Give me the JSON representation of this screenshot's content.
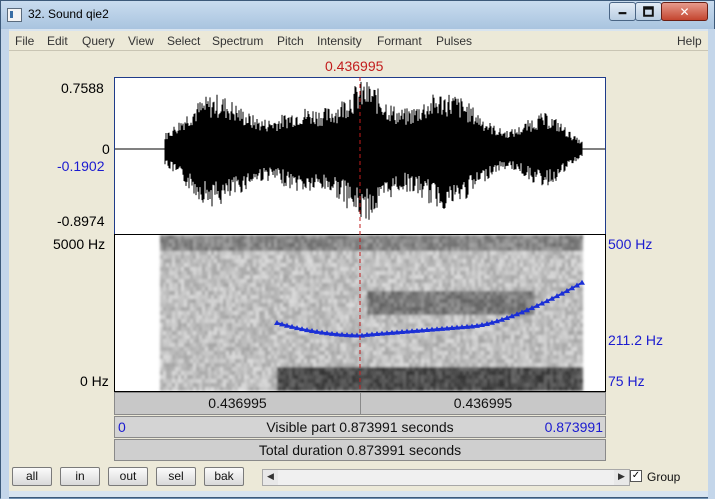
{
  "window": {
    "title": "32. Sound qie2",
    "buttons": {
      "minimize": "🗕",
      "maximize": "🗖",
      "close": "✕"
    }
  },
  "menu": [
    "File",
    "Edit",
    "Query",
    "View",
    "Select",
    "Spectrum",
    "Pitch",
    "Intensity",
    "Formant",
    "Pulses",
    "Help"
  ],
  "cursor_time": "0.436995",
  "waveform": {
    "top": "0.7588",
    "zero": "0",
    "cursor_value": "-0.1902",
    "bottom": "-0.8974"
  },
  "spectrogram": {
    "freq_top": "5000 Hz",
    "freq_bottom": "0 Hz",
    "pitch_top": "500 Hz",
    "pitch_mid": "211.2 Hz",
    "pitch_bottom": "75 Hz"
  },
  "time_bar": {
    "left": "0.436995",
    "right": "0.436995"
  },
  "visible_bar": {
    "start": "0",
    "label": "Visible part 0.873991 seconds",
    "end": "0.873991"
  },
  "total_bar": {
    "label": "Total duration 0.873991 seconds"
  },
  "bottom_buttons": [
    "all",
    "in",
    "out",
    "sel",
    "bak"
  ],
  "group": {
    "label": "Group",
    "checked": true
  },
  "colors": {
    "cursor": "#c21d1d",
    "pitch": "#1b2fd6",
    "axis_blue": "#1b1bd0"
  }
}
